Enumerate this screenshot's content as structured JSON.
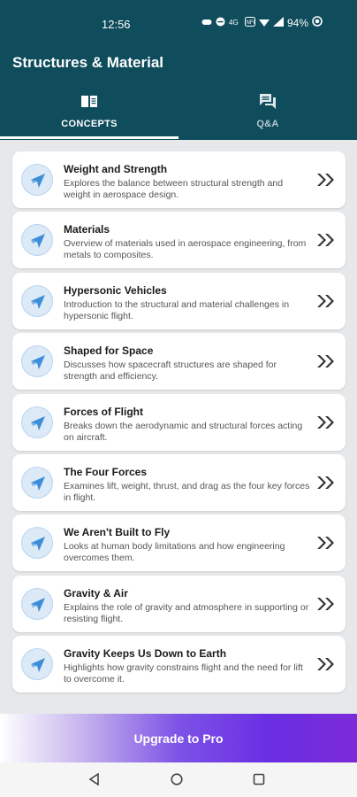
{
  "status_bar": {
    "time": "12:56",
    "battery": "94%",
    "icons": [
      "game-controller-icon",
      "do-not-disturb-icon",
      "volte-icon",
      "nfc-icon",
      "wifi-icon",
      "signal-icon",
      "battery-icon"
    ]
  },
  "header": {
    "title": "Structures & Material",
    "background_color": "#0f4c5c"
  },
  "tabs": [
    {
      "label": "CONCEPTS",
      "icon": "book-icon",
      "active": true
    },
    {
      "label": "Q&A",
      "icon": "chat-icon",
      "active": false
    }
  ],
  "concepts": [
    {
      "title": "Weight and Strength",
      "description": "Explores the balance between structural strength and weight in aerospace design."
    },
    {
      "title": "Materials",
      "description": "Overview of materials used in aerospace engineering, from metals to composites."
    },
    {
      "title": "Hypersonic Vehicles",
      "description": "Introduction to the structural and material challenges in hypersonic flight."
    },
    {
      "title": "Shaped for Space",
      "description": "Discusses how spacecraft structures are shaped for strength and efficiency."
    },
    {
      "title": "Forces of Flight",
      "description": "Breaks down the aerodynamic and structural forces acting on aircraft."
    },
    {
      "title": "The Four Forces",
      "description": "Examines lift, weight, thrust, and drag as the four key forces in flight."
    },
    {
      "title": "We Aren't Built to Fly",
      "description": "Looks at human body limitations and how engineering overcomes them."
    },
    {
      "title": "Gravity & Air",
      "description": "Explains the role of gravity and atmosphere in supporting or resisting flight."
    },
    {
      "title": "Gravity Keeps Us Down to Earth",
      "description": "Highlights how gravity constrains flight and the need for lift to overcome it."
    }
  ],
  "upgrade": {
    "label": "Upgrade to Pro",
    "accent_color": "#6a2ee4"
  },
  "navigation_bar": [
    "back-icon",
    "home-icon",
    "recents-icon"
  ]
}
